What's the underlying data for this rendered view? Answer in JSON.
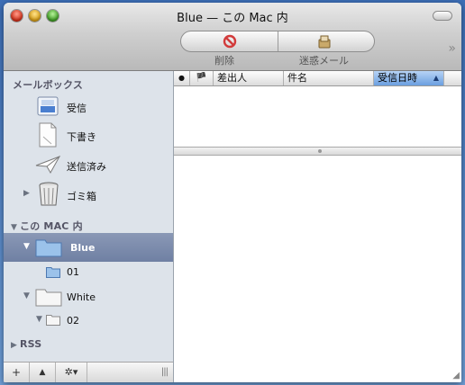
{
  "window": {
    "title": "Blue — この Mac 内"
  },
  "toolbar": {
    "delete_label": "削除",
    "junk_label": "迷惑メール"
  },
  "sidebar": {
    "mailboxes_header": "メールボックス",
    "items": [
      {
        "label": "受信",
        "icon": "inbox-icon"
      },
      {
        "label": "下書き",
        "icon": "drafts-icon"
      },
      {
        "label": "送信済み",
        "icon": "sent-icon"
      },
      {
        "label": "ゴミ箱",
        "icon": "trash-icon"
      }
    ],
    "on_mac_header": "この MAC 内",
    "folders": [
      {
        "label": "Blue",
        "icon": "folder-icon",
        "selected": true
      },
      {
        "label": "01",
        "icon": "folder-icon"
      },
      {
        "label": "White",
        "icon": "folder-icon"
      },
      {
        "label": "02",
        "icon": "folder-icon"
      }
    ],
    "rss_header": "RSS",
    "bottom": {
      "add": "+",
      "show": "▲",
      "action": "✲▾"
    }
  },
  "list": {
    "columns": {
      "read": "●",
      "flag": "🏴",
      "from": "差出人",
      "subject": "件名",
      "date": "受信日時"
    },
    "sort_indicator": "▲"
  },
  "colors": {
    "selection": "#7586a8",
    "sorted_column": "#7aa7e6",
    "desktop": "#4f7fc4"
  }
}
